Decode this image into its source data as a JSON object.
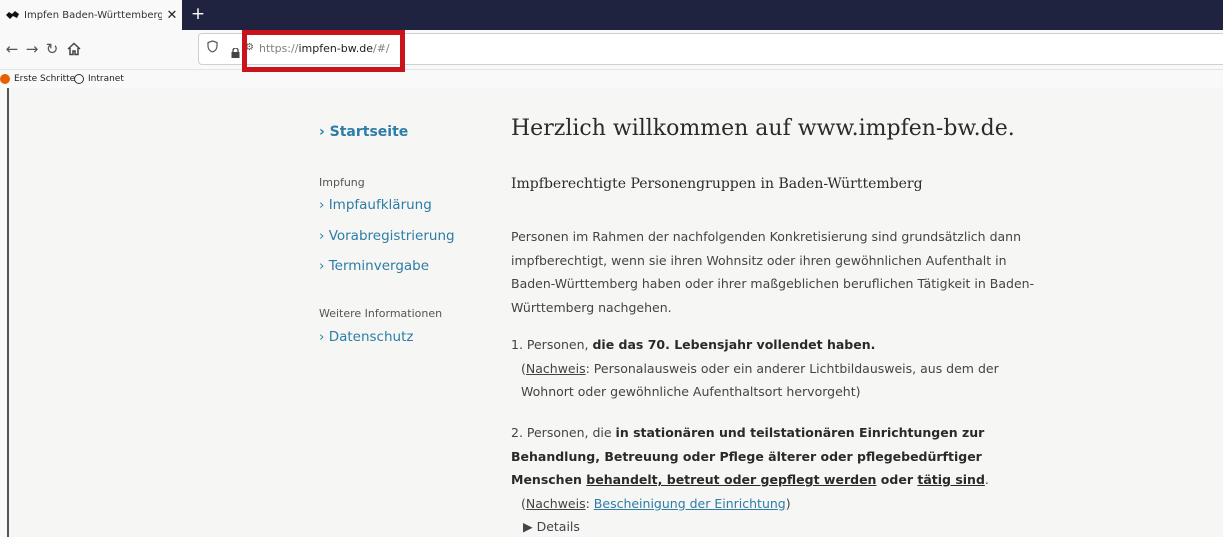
{
  "browser": {
    "tab_title": "Impfen Baden-Württemberg",
    "tab_close": "✕",
    "new_tab": "+",
    "url_prefix": "https://",
    "url_host": "impfen-bw.de",
    "url_path": "/#/",
    "bookmarks": [
      "Erste Schritte",
      "Intranet"
    ],
    "accent_highlight": "#c8141a"
  },
  "sidebar": {
    "home": "› Startseite",
    "section1_heading": "Impfung",
    "section1_links": [
      "› Impfaufklärung",
      "› Vorabregistrierung",
      "› Terminvergabe"
    ],
    "section2_heading": "Weitere Informationen",
    "section2_links": [
      "› Datenschutz"
    ]
  },
  "main": {
    "title": "Herzlich willkommen auf www.impfen-bw.de.",
    "subtitle": "Impfberechtigte Personengruppen in Baden-Württemberg",
    "intro": "Personen im Rahmen der nachfolgenden Konkretisierung sind grundsätzlich dann impfberechtigt, wenn sie ihren Wohnsitz oder ihren gewöhnlichen Aufenthalt in Baden-Württemberg haben oder ihrer maßgeblichen beruflichen Tätigkeit in Baden-Württemberg nachgehen.",
    "item1": {
      "prefix": "1. Personen, ",
      "bold": "die das 70. Lebensjahr vollendet haben.",
      "open_paren": "(",
      "nachweis": "Nachweis",
      "proof_text": ": Personalausweis oder ein anderer Lichtbildausweis, aus dem der Wohnort oder gewöhnliche Aufenthaltsort hervorgeht)"
    },
    "item2": {
      "prefix": "2. Personen, die ",
      "bold1": "in stationären und teilstationären Einrichtungen zur Behandlung, Betreuung oder Pflege älterer oder pflegebedürftiger Menschen ",
      "bold_u1": "behandelt, betreut oder gepflegt werden",
      "bold2": " oder ",
      "bold_u2": "tätig sind",
      "period": ".",
      "open_paren": "(",
      "nachweis": "Nachweis",
      "colon": ": ",
      "proof_link": "Bescheinigung der Einrichtung",
      "close_paren": ")"
    },
    "details": "▶ Details"
  }
}
